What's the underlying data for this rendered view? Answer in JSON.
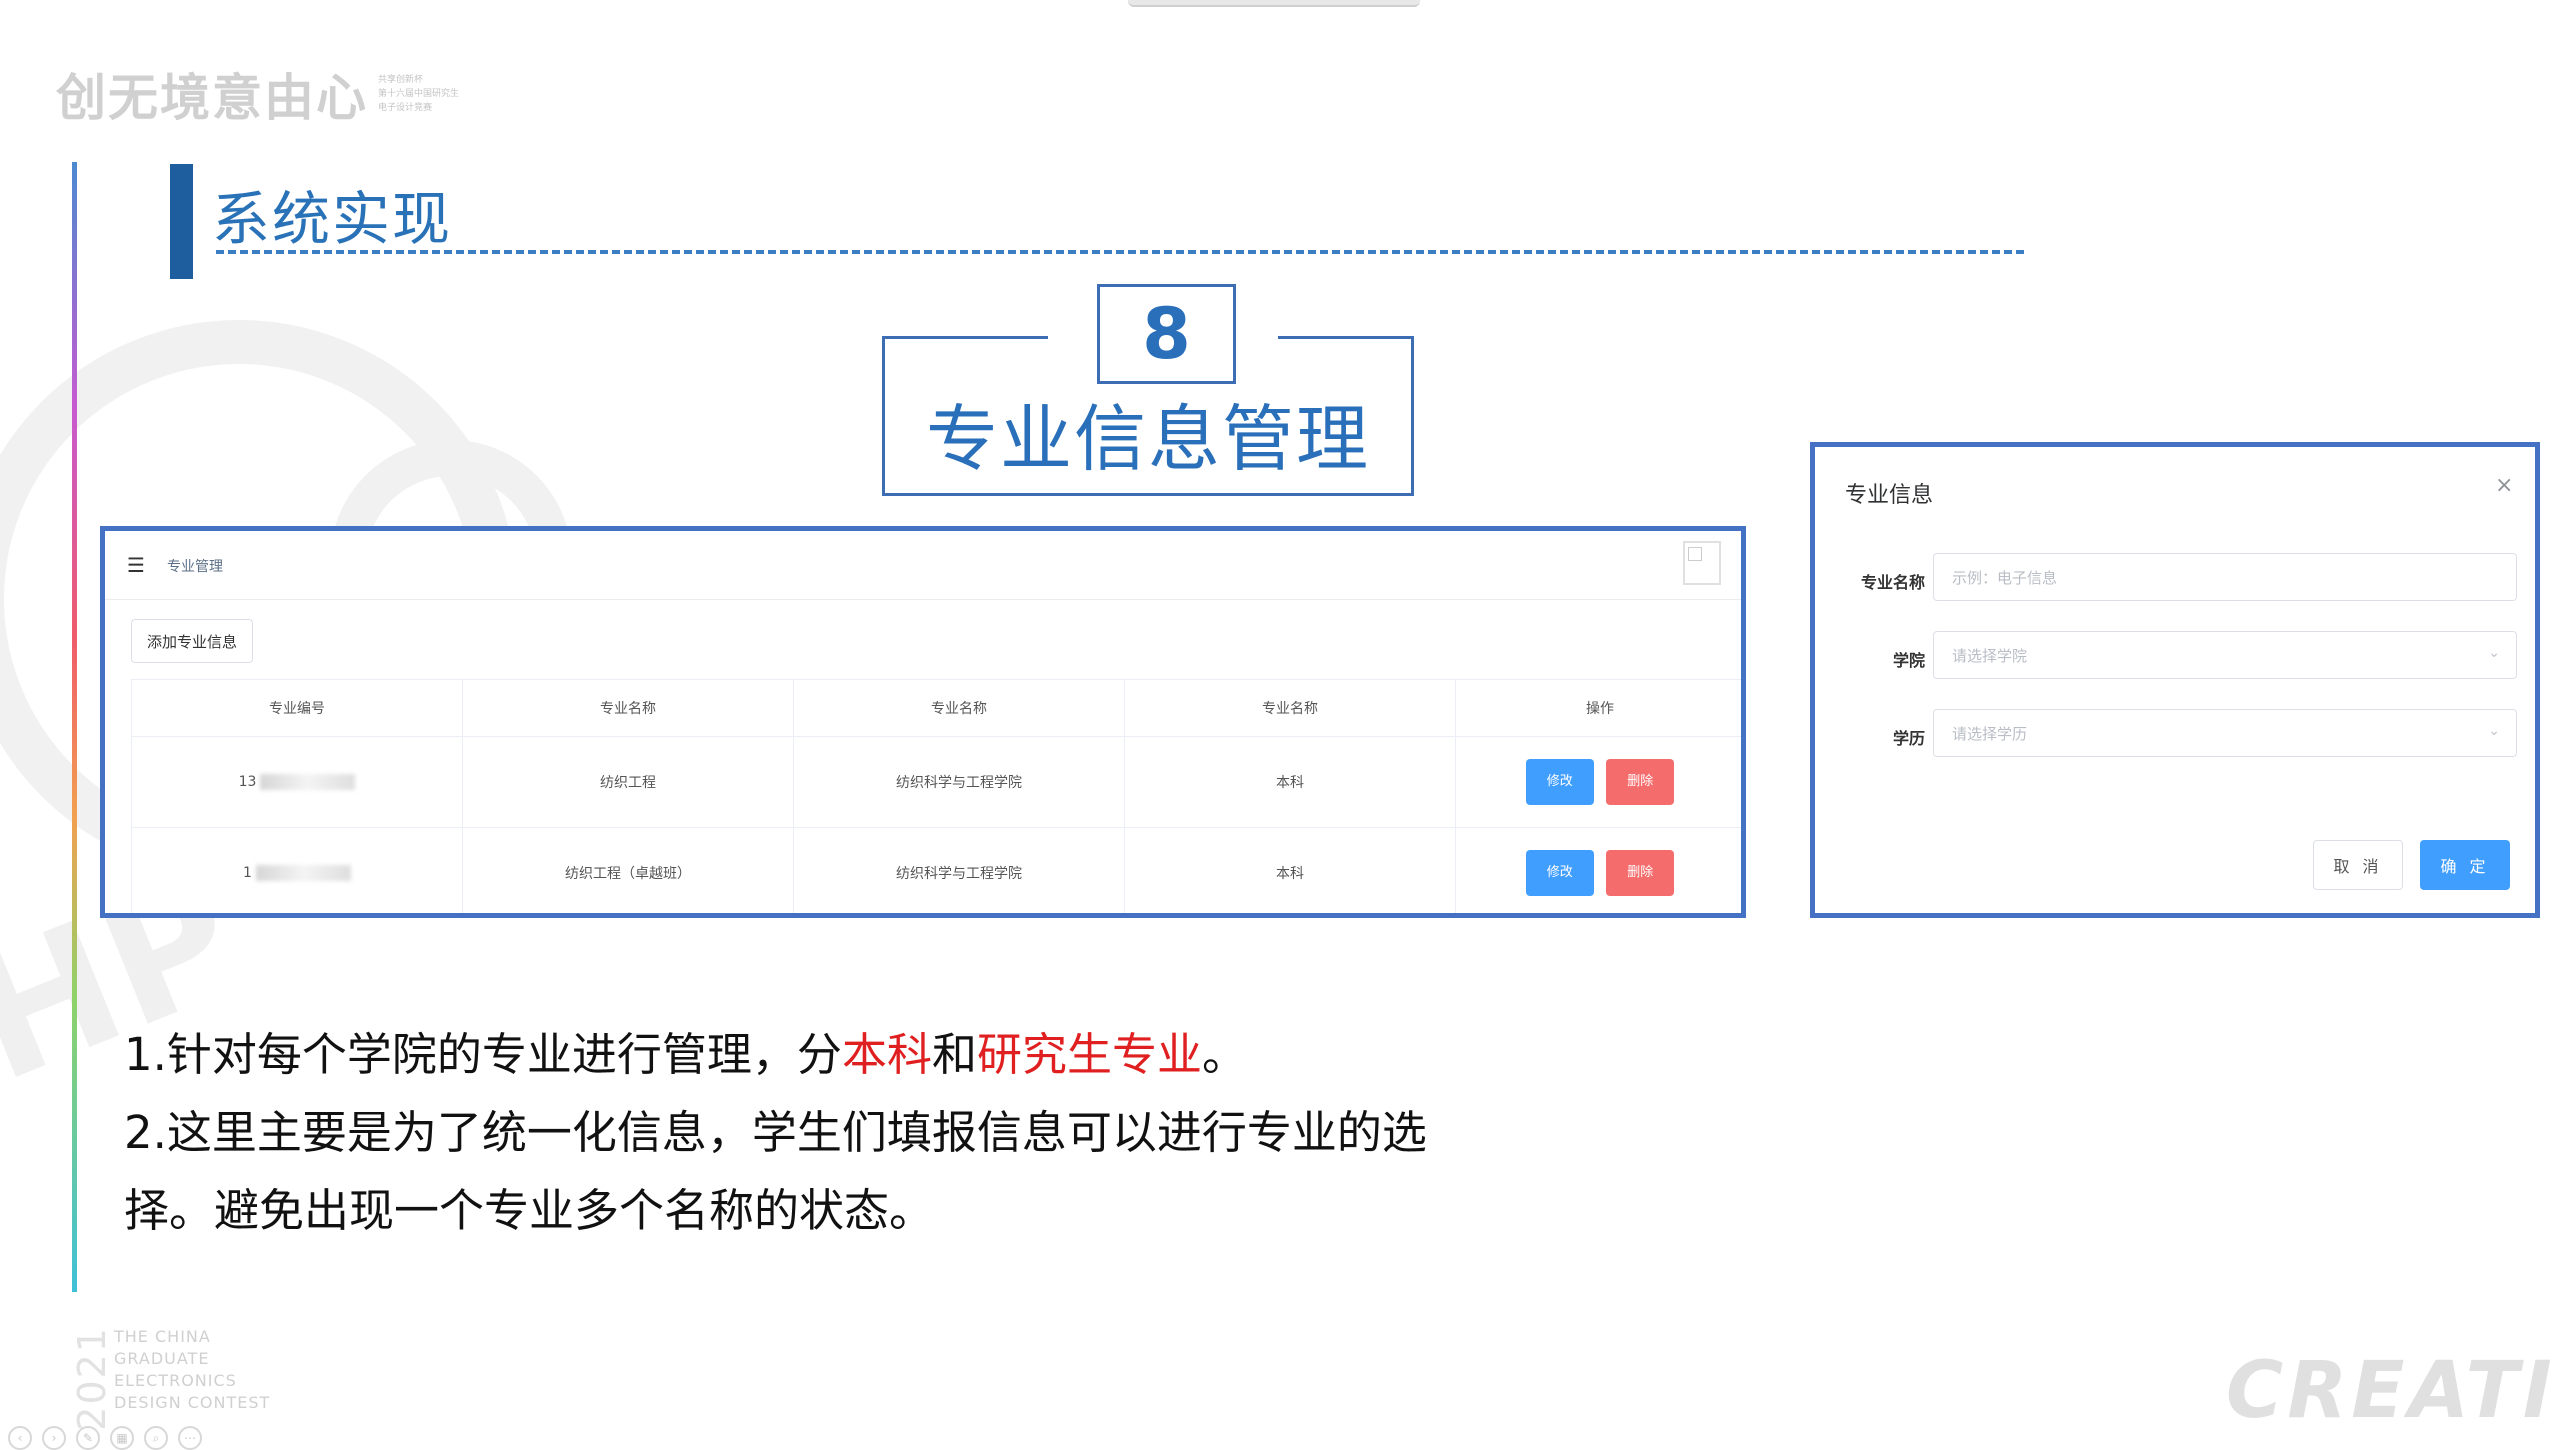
{
  "logo": {
    "mark": "创无境意由心",
    "sub_lines": [
      "共享创新杯",
      "第十六届中国研究生",
      "电子设计竞赛"
    ]
  },
  "section": {
    "title": "系统实现"
  },
  "module": {
    "number": "8",
    "title": "专业信息管理"
  },
  "major_panel": {
    "breadcrumb": "专业管理",
    "add_button": "添加专业信息",
    "columns": [
      "专业编号",
      "专业名称",
      "专业名称",
      "专业名称",
      "操作"
    ],
    "rows": [
      {
        "id": "13",
        "major": "纺织工程",
        "college": "纺织科学与工程学院",
        "level": "本科"
      },
      {
        "id": "1",
        "major": "纺织工程（卓越班）",
        "college": "纺织科学与工程学院",
        "level": "本科"
      }
    ],
    "edit_label": "修改",
    "delete_label": "删除"
  },
  "dialog": {
    "title": "专业信息",
    "close_icon": "close-icon",
    "fields": [
      {
        "label": "专业名称",
        "placeholder": "示例：电子信息",
        "type": "text"
      },
      {
        "label": "学院",
        "placeholder": "请选择学院",
        "type": "select"
      },
      {
        "label": "学历",
        "placeholder": "请选择学历",
        "type": "select"
      }
    ],
    "cancel_label": "取 消",
    "ok_label": "确 定"
  },
  "description": {
    "line1_prefix": "1.针对每个学院的专业进行管理，分",
    "line1_red1": "本科",
    "line1_mid": "和",
    "line1_red2": "研究生专业",
    "line1_suffix": "。",
    "line2": "2.这里主要是为了统一化信息，学生们填报信息可以进行专业的选",
    "line3": "择。避免出现一个专业多个名称的状态。"
  },
  "contest": {
    "year": "2021",
    "lines": [
      "THE CHINA",
      "GRADUATE",
      "ELECTRONICS",
      "DESIGN CONTEST"
    ]
  },
  "footer": {
    "wordmark": "CREATIVE"
  },
  "colors": {
    "accent_blue": "#2a6fba",
    "frame_blue": "#4471c4",
    "highlight_red": "#e02020",
    "btn_primary": "#409eff",
    "btn_danger": "#f56c6c"
  }
}
